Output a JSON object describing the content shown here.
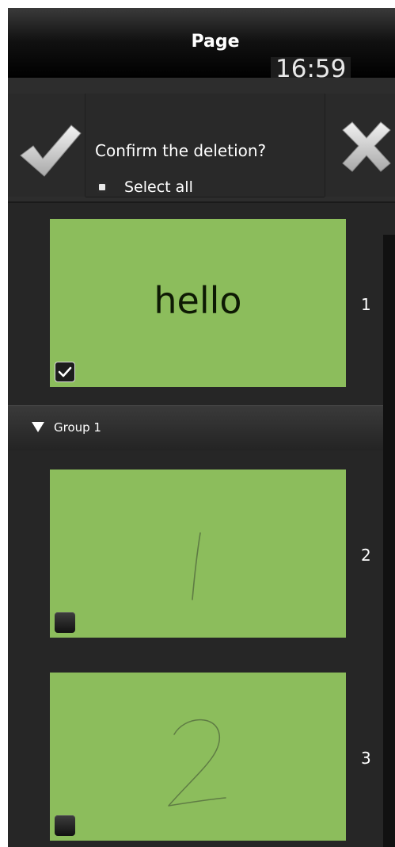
{
  "header": {
    "title": "Page",
    "clock": "16:59"
  },
  "confirm": {
    "question": "Confirm the deletion?",
    "ok_icon": "checkmark-icon",
    "cancel_icon": "close-icon",
    "select_all_label": "Select all",
    "select_all_checked": false
  },
  "pages": [
    {
      "number": "1",
      "content": "hello",
      "checked": true
    },
    {
      "number": "2",
      "content": "1",
      "checked": false
    },
    {
      "number": "3",
      "content": "2",
      "checked": false
    }
  ],
  "group": {
    "label": "Group 1",
    "expanded": true
  },
  "colors": {
    "thumbnail_bg": "#8cbd5c",
    "panel_bg": "#262626"
  }
}
